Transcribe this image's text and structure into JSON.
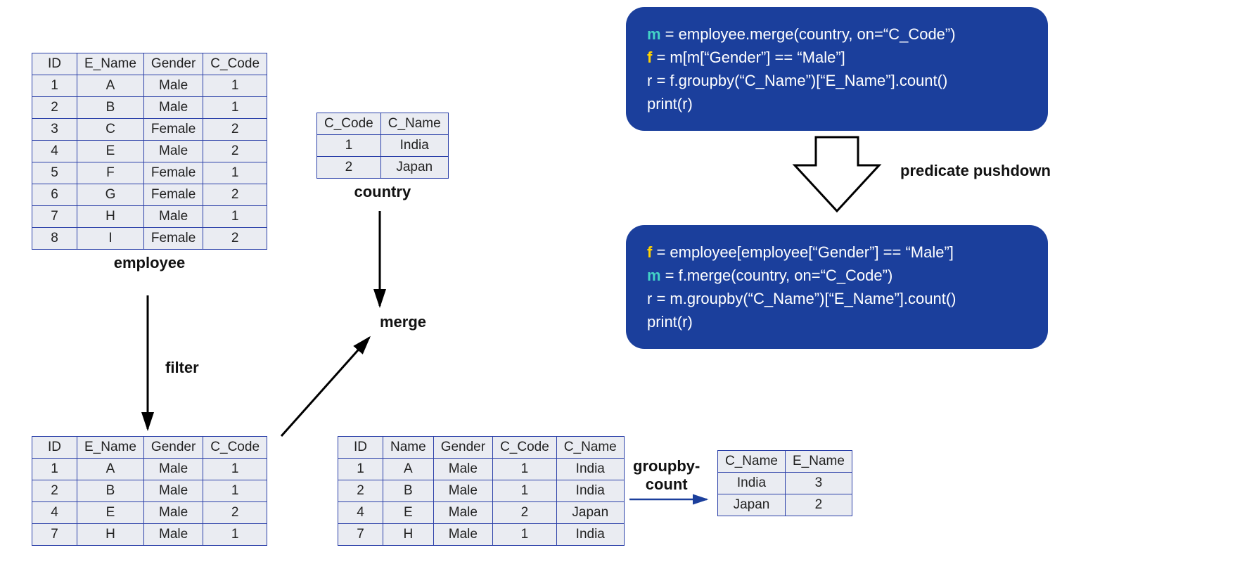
{
  "employee": {
    "caption": "employee",
    "headers": [
      "ID",
      "E_Name",
      "Gender",
      "C_Code"
    ],
    "rows": [
      [
        "1",
        "A",
        "Male",
        "1"
      ],
      [
        "2",
        "B",
        "Male",
        "1"
      ],
      [
        "3",
        "C",
        "Female",
        "2"
      ],
      [
        "4",
        "E",
        "Male",
        "2"
      ],
      [
        "5",
        "F",
        "Female",
        "1"
      ],
      [
        "6",
        "G",
        "Female",
        "2"
      ],
      [
        "7",
        "H",
        "Male",
        "1"
      ],
      [
        "8",
        "I",
        "Female",
        "2"
      ]
    ]
  },
  "country": {
    "caption": "country",
    "headers": [
      "C_Code",
      "C_Name"
    ],
    "rows": [
      [
        "1",
        "India"
      ],
      [
        "2",
        "Japan"
      ]
    ]
  },
  "filtered": {
    "headers": [
      "ID",
      "E_Name",
      "Gender",
      "C_Code"
    ],
    "rows": [
      [
        "1",
        "A",
        "Male",
        "1"
      ],
      [
        "2",
        "B",
        "Male",
        "1"
      ],
      [
        "4",
        "E",
        "Male",
        "2"
      ],
      [
        "7",
        "H",
        "Male",
        "1"
      ]
    ]
  },
  "merged": {
    "headers": [
      "ID",
      "Name",
      "Gender",
      "C_Code",
      "C_Name"
    ],
    "rows": [
      [
        "1",
        "A",
        "Male",
        "1",
        "India"
      ],
      [
        "2",
        "B",
        "Male",
        "1",
        "India"
      ],
      [
        "4",
        "E",
        "Male",
        "2",
        "Japan"
      ],
      [
        "7",
        "H",
        "Male",
        "1",
        "India"
      ]
    ]
  },
  "result": {
    "headers": [
      "C_Name",
      "E_Name"
    ],
    "rows": [
      [
        "India",
        "3"
      ],
      [
        "Japan",
        "2"
      ]
    ]
  },
  "ops": {
    "filter": "filter",
    "merge": "merge",
    "groupby": "groupby-\ncount"
  },
  "predicate_label": "predicate pushdown",
  "code_before": {
    "l1a": "m",
    "l1b": " = employee.merge(country, on=“C_Code”)",
    "l2a": "f",
    "l2b": " = m[m[“Gender”] == “Male”]",
    "l3": "r = f.groupby(“C_Name”)[“E_Name”].count()",
    "l4": "print(r)"
  },
  "code_after": {
    "l1a": "f",
    "l1b": " = employee[employee[“Gender”] == “Male”]",
    "l2a": "m",
    "l2b": " = f.merge(country, on=“C_Code”)",
    "l3": "r = m.groupby(“C_Name”)[“E_Name”].count()",
    "l4": "print(r)"
  }
}
